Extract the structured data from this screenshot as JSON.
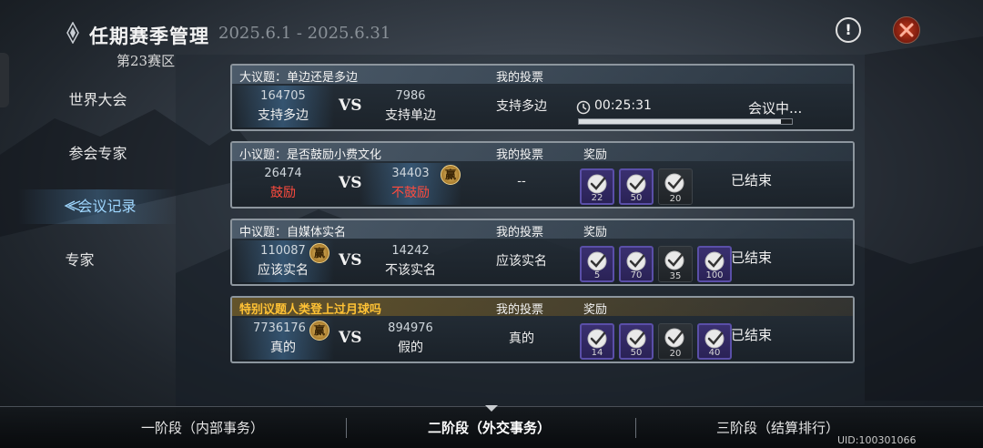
{
  "header": {
    "title": "任期赛季管理",
    "date_range": "2025.6.1 - 2025.6.31",
    "season": "第23赛区",
    "info_label": "!"
  },
  "sidebar": {
    "items": [
      {
        "label": "世界大会"
      },
      {
        "label": "参会专家"
      },
      {
        "label": "会议记录"
      },
      {
        "label": "专家"
      }
    ],
    "active_index": 2
  },
  "columns": {
    "my_vote": "我的投票",
    "reward": "奖励"
  },
  "win_badge": "赢",
  "vs": "VS",
  "cards": [
    {
      "topic": "大议题：单边还是多边",
      "left_count": "164705",
      "left_option": "支持多边",
      "right_count": "7986",
      "right_option": "支持单边",
      "my_vote": "支持多边",
      "timer": "00:25:31",
      "status": "会议中...",
      "progress": 0.95
    },
    {
      "topic": "小议题：是否鼓励小费文化",
      "left_count": "26474",
      "left_option": "鼓励",
      "right_count": "34403",
      "right_option": "不鼓励",
      "my_vote": "--",
      "status": "已结束",
      "rewards": [
        "22",
        "50",
        "20"
      ]
    },
    {
      "topic": "中议题：自媒体实名",
      "left_count": "110087",
      "left_option": "应该实名",
      "right_count": "14242",
      "right_option": "不该实名",
      "my_vote": "应该实名",
      "status": "已结束",
      "rewards": [
        "5",
        "70",
        "35",
        "100"
      ]
    },
    {
      "topic": "特别议题人类登上过月球吗",
      "left_count": "7736176",
      "left_option": "真的",
      "right_count": "894976",
      "right_option": "假的",
      "my_vote": "真的",
      "status": "已结束",
      "rewards": [
        "14",
        "50",
        "20",
        "40"
      ]
    }
  ],
  "bottom": {
    "phases": [
      "一阶段（内部事务）",
      "二阶段（外交事务）",
      "三阶段（结算排行）"
    ],
    "active_phase": 1,
    "uid": "UID:100301066"
  },
  "colors": {
    "accent_blue": "#9fd7ff",
    "red_option": "#ff4b3e",
    "special_topic": "#ffc235",
    "reward_purple": "#3a3070"
  }
}
